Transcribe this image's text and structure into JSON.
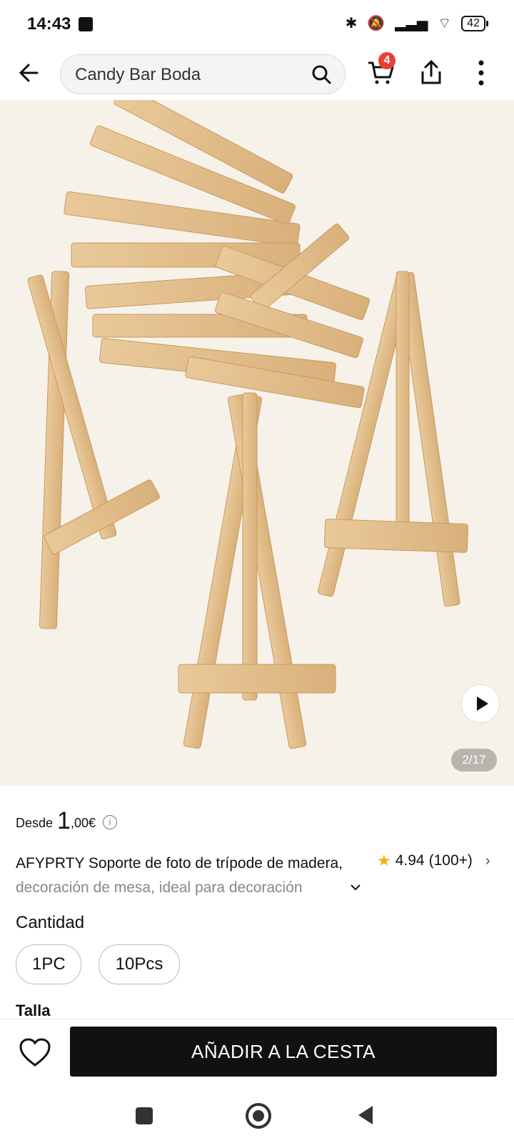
{
  "status": {
    "time": "14:43",
    "battery": "42"
  },
  "header": {
    "search_value": "Candy Bar Boda",
    "cart_count": "4"
  },
  "gallery": {
    "counter": "2/17"
  },
  "price": {
    "from": "Desde",
    "main": "1",
    "decimals": ",00€",
    "info": "i"
  },
  "product": {
    "title_line1": "AFYPRTY Soporte de foto de trípode de madera,",
    "title_line2": "decoración de mesa, ideal para decoración",
    "rating": "4.94",
    "reviews": "(100+)"
  },
  "quantity": {
    "label": "Cantidad",
    "options": [
      "1PC",
      "10Pcs"
    ]
  },
  "size": {
    "label": "Talla"
  },
  "actions": {
    "add_to_cart": "AÑADIR A LA CESTA"
  },
  "icons": {
    "back": "back-arrow-icon",
    "search": "search-icon",
    "cart": "cart-icon",
    "share": "share-icon",
    "more": "more-vertical-icon",
    "play": "play-icon",
    "heart": "heart-icon",
    "star": "star-icon"
  }
}
